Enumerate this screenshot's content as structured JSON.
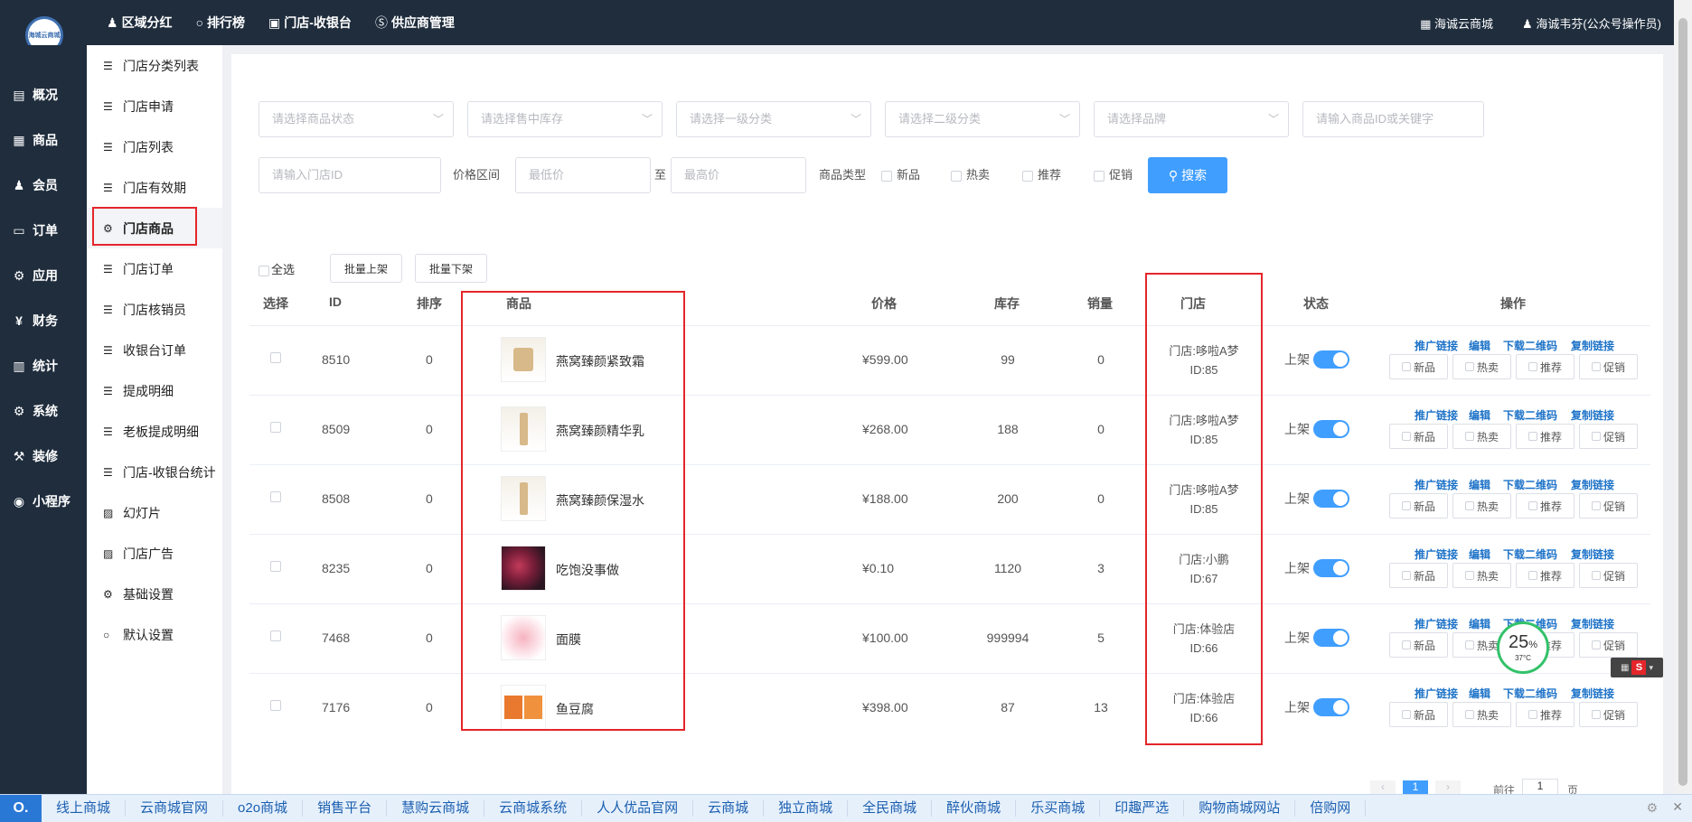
{
  "topbar": {
    "logo_text": "海城云商城",
    "nav": [
      {
        "icon": "person-icon",
        "glyph": "♟",
        "label": "区域分红"
      },
      {
        "icon": "circle-icon",
        "glyph": "○",
        "label": "排行榜"
      },
      {
        "icon": "camera-icon",
        "glyph": "▣",
        "label": "门店-收银台"
      },
      {
        "icon": "skype-icon",
        "glyph": "Ⓢ",
        "label": "供应商管理"
      }
    ],
    "store_name": "海诚云商城",
    "user_name": "海诚韦芬(公众号操作员)"
  },
  "sidebar": {
    "items": [
      {
        "icon": "overview-icon",
        "glyph": "▤",
        "label": "概况"
      },
      {
        "icon": "goods-icon",
        "glyph": "▦",
        "label": "商品"
      },
      {
        "icon": "members-icon",
        "glyph": "♟",
        "label": "会员"
      },
      {
        "icon": "cart-icon",
        "glyph": "🛒",
        "label": "订单"
      },
      {
        "icon": "apps-icon",
        "glyph": "⚙",
        "label": "应用"
      },
      {
        "icon": "yen-icon",
        "glyph": "¥",
        "label": "财务"
      },
      {
        "icon": "chart-icon",
        "glyph": "▥",
        "label": "统计"
      },
      {
        "icon": "gears-icon",
        "glyph": "⚙",
        "label": "系统"
      },
      {
        "icon": "hammer-icon",
        "glyph": "⚒",
        "label": "装修"
      },
      {
        "icon": "wechat-icon",
        "glyph": "◉",
        "label": "小程序"
      }
    ]
  },
  "submenu": {
    "items": [
      {
        "icon": "list-icon",
        "glyph": "☰",
        "label": "门店分类列表"
      },
      {
        "icon": "list-icon",
        "glyph": "☰",
        "label": "门店申请"
      },
      {
        "icon": "list-icon",
        "glyph": "☰",
        "label": "门店列表"
      },
      {
        "icon": "list-icon",
        "glyph": "☰",
        "label": "门店有效期"
      },
      {
        "icon": "cubes-icon",
        "glyph": "⚙",
        "label": "门店商品"
      },
      {
        "icon": "list-icon",
        "glyph": "☰",
        "label": "门店订单"
      },
      {
        "icon": "list-icon",
        "glyph": "☰",
        "label": "门店核销员"
      },
      {
        "icon": "list-icon",
        "glyph": "☰",
        "label": "收银台订单"
      },
      {
        "icon": "list-icon",
        "glyph": "☰",
        "label": "提成明细"
      },
      {
        "icon": "list-icon",
        "glyph": "☰",
        "label": "老板提成明细"
      },
      {
        "icon": "list-icon",
        "glyph": "☰",
        "label": "门店-收银台统计"
      },
      {
        "icon": "image-icon",
        "glyph": "▨",
        "label": "幻灯片"
      },
      {
        "icon": "image-icon",
        "glyph": "▨",
        "label": "门店广告"
      },
      {
        "icon": "gears-icon",
        "glyph": "⚙",
        "label": "基础设置"
      },
      {
        "icon": "circle-icon",
        "glyph": "○",
        "label": "默认设置"
      }
    ]
  },
  "filter": {
    "status_placeholder": "请选择商品状态",
    "stock_placeholder": "请选择售中库存",
    "cat1_placeholder": "请选择一级分类",
    "cat2_placeholder": "请选择二级分类",
    "brand_placeholder": "请选择品牌",
    "keyword_placeholder": "请输入商品ID或关键字",
    "store_placeholder": "请输入门店ID",
    "price_label": "价格区间",
    "min_placeholder": "最低价",
    "to_label": "至",
    "max_placeholder": "最高价",
    "type_label": "商品类型",
    "types": [
      "新品",
      "热卖",
      "推荐",
      "促销"
    ],
    "search_label": "搜索"
  },
  "table": {
    "select_all": "全选",
    "batch_on": "批量上架",
    "batch_off": "批量下架",
    "headers": {
      "select": "选择",
      "id": "ID",
      "sort": "排序",
      "goods": "商品",
      "price": "价格",
      "stock": "库存",
      "sales": "销量",
      "store": "门店",
      "status": "状态",
      "ops": "操作"
    },
    "op_links": [
      "推广链接",
      "编辑",
      "下载二维码",
      "复制链接"
    ],
    "tags": [
      "新品",
      "热卖",
      "推荐",
      "促销"
    ],
    "status_label": "上架",
    "rows": [
      {
        "id": "8510",
        "sort": "0",
        "name": "燕窝臻颜紧致霜",
        "price": "¥599.00",
        "stock": "99",
        "sales": "0",
        "store": "门店:哆啦A梦",
        "store_id": "ID:85",
        "thumb": "cream-jar"
      },
      {
        "id": "8509",
        "sort": "0",
        "name": "燕窝臻颜精华乳",
        "price": "¥268.00",
        "stock": "188",
        "sales": "0",
        "store": "门店:哆啦A梦",
        "store_id": "ID:85",
        "thumb": "bottle"
      },
      {
        "id": "8508",
        "sort": "0",
        "name": "燕窝臻颜保湿水",
        "price": "¥188.00",
        "stock": "200",
        "sales": "0",
        "store": "门店:哆啦A梦",
        "store_id": "ID:85",
        "thumb": "bottle"
      },
      {
        "id": "8235",
        "sort": "0",
        "name": "吃饱没事做",
        "price": "¥0.10",
        "stock": "1120",
        "sales": "3",
        "store": "门店:小鹏",
        "store_id": "ID:67",
        "thumb": "fruit"
      },
      {
        "id": "7468",
        "sort": "0",
        "name": "面膜",
        "price": "¥100.00",
        "stock": "999994",
        "sales": "5",
        "store": "门店:体验店",
        "store_id": "ID:66",
        "thumb": "mask"
      },
      {
        "id": "7176",
        "sort": "0",
        "name": "鱼豆腐",
        "price": "¥398.00",
        "stock": "87",
        "sales": "13",
        "store": "门店:体验店",
        "store_id": "ID:66",
        "thumb": "box"
      }
    ]
  },
  "pager": {
    "current": "1",
    "goto": "前往",
    "goto_value": "1",
    "page_unit": "页"
  },
  "widget": {
    "percent": "25",
    "percent_sign": "%",
    "temp": "37°C"
  },
  "bottom_links": [
    "线上商城",
    "云商城官网",
    "o2o商城",
    "销售平台",
    "慧购云商城",
    "云商城系统",
    "人人优品官网",
    "云商城",
    "独立商城",
    "全民商城",
    "醉伙商城",
    "乐买商城",
    "印趣严选",
    "购物商城网站",
    "倍购网"
  ]
}
